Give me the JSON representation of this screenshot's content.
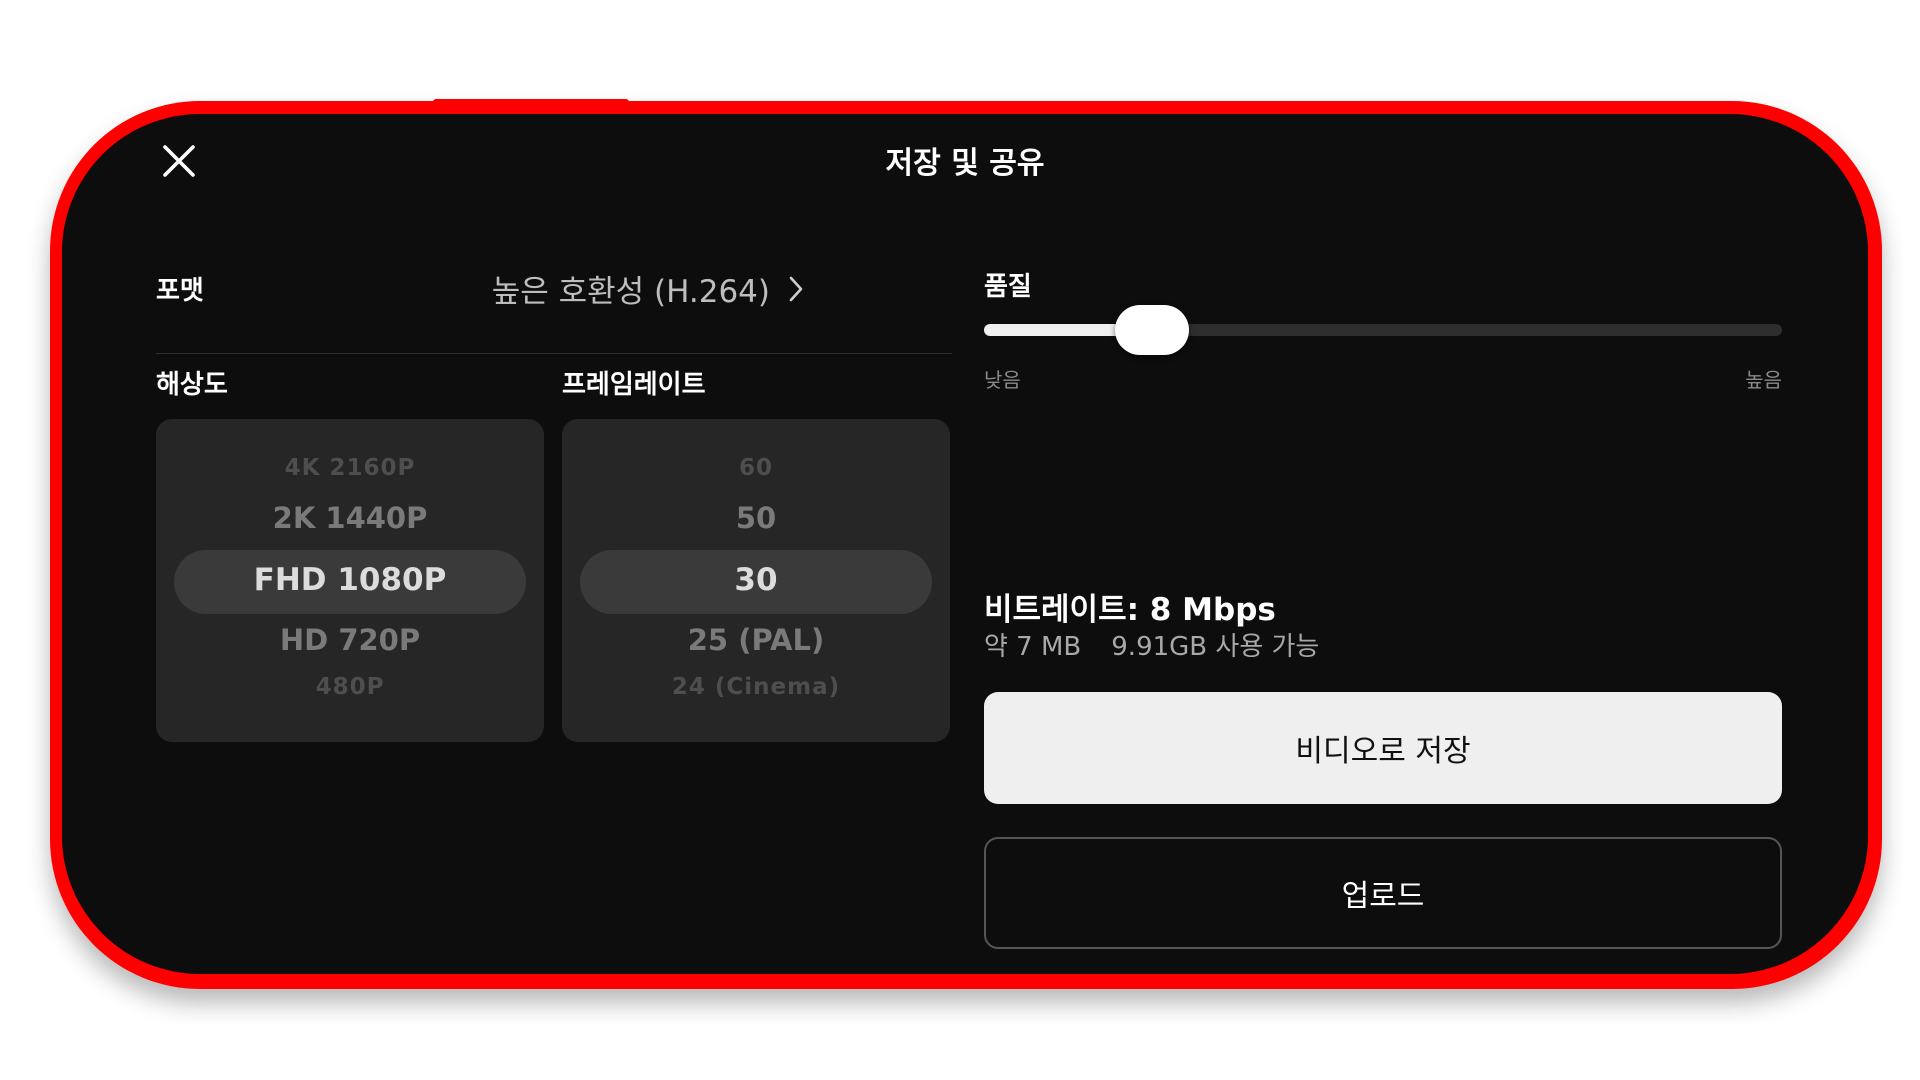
{
  "header": {
    "title": "저장 및 공유",
    "close_icon": "close-icon"
  },
  "format": {
    "label": "포맷",
    "value": "높은 호환성 (H.264)",
    "chevron_icon": "chevron-right-icon"
  },
  "resolution": {
    "label": "해상도",
    "options": [
      "4K 2160P",
      "2K 1440P",
      "FHD 1080P",
      "HD 720P",
      "480P"
    ],
    "selected": "FHD 1080P"
  },
  "framerate": {
    "label": "프레임레이트",
    "options": [
      "60",
      "50",
      "30",
      "25 (PAL)",
      "24 (Cinema)"
    ],
    "selected": "30"
  },
  "quality": {
    "label": "품질",
    "low_label": "낮음",
    "high_label": "높음",
    "value_fraction": 0.21
  },
  "bitrate": {
    "text": "비트레이트: 8 Mbps"
  },
  "storage": {
    "estimated_size": "약 7 MB",
    "available": "9.91GB 사용 가능"
  },
  "actions": {
    "save_label": "비디오로 저장",
    "upload_label": "업로드"
  },
  "colors": {
    "frame": "#ff0000",
    "screen_bg": "#0d0d0d",
    "picker_bg": "#262626",
    "highlight_bg": "#3a3a3a",
    "save_button_bg": "#efefef"
  }
}
